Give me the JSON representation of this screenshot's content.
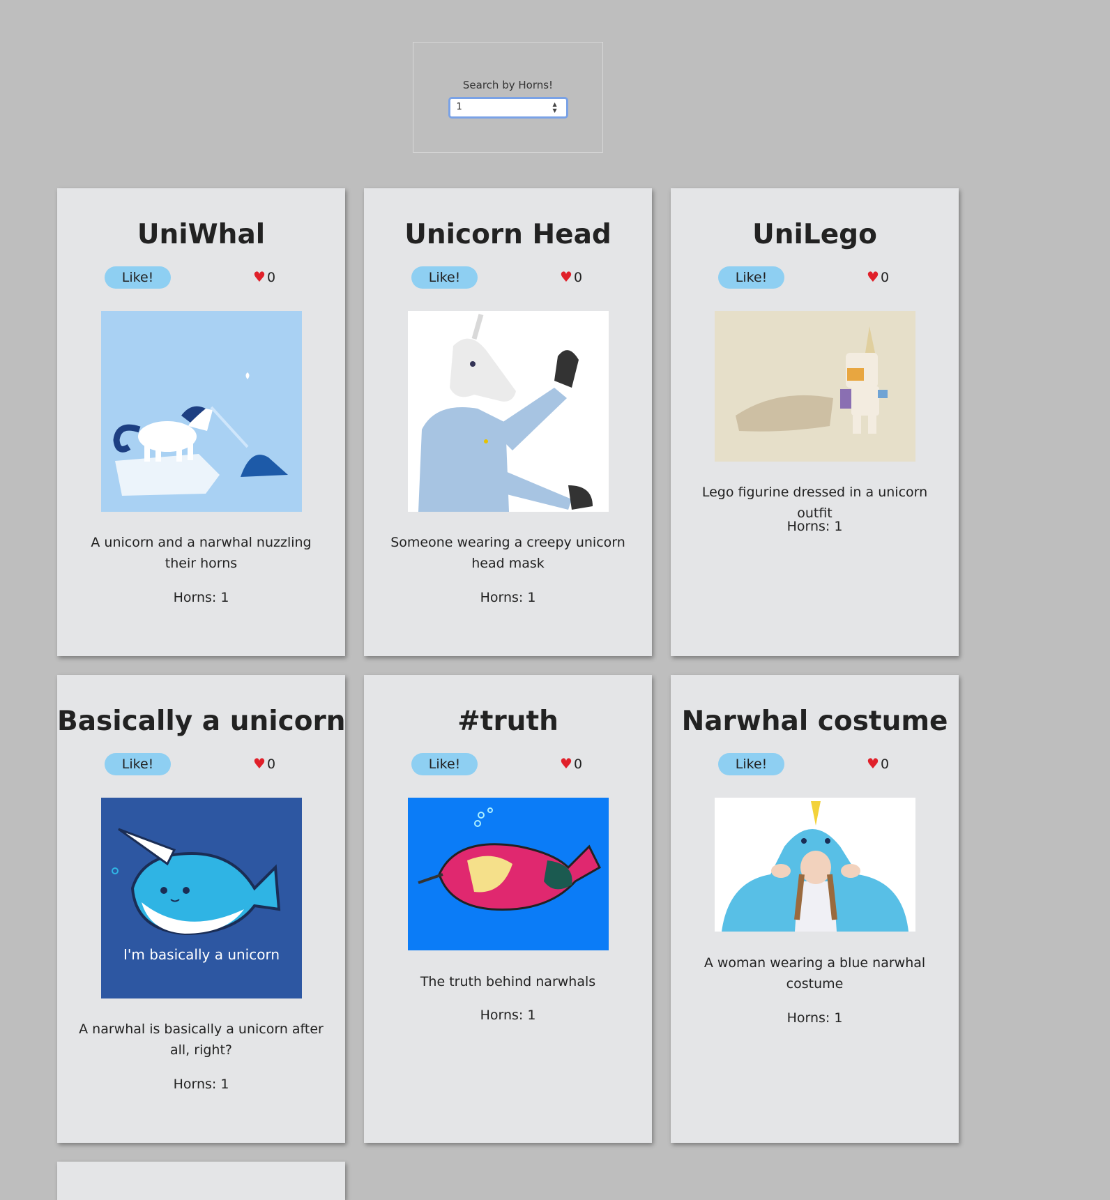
{
  "search": {
    "label": "Search by Horns!",
    "value": "1"
  },
  "cards": [
    {
      "title": "UniWhal",
      "like_label": "Like!",
      "likes": "0",
      "description": "A unicorn and a narwhal nuzzling their horns",
      "horns": "Horns: 1"
    },
    {
      "title": "Unicorn Head",
      "like_label": "Like!",
      "likes": "0",
      "description": "Someone wearing a creepy unicorn head mask",
      "horns": "Horns: 1"
    },
    {
      "title": "UniLego",
      "like_label": "Like!",
      "likes": "0",
      "description": "Lego figurine dressed in a unicorn outfit",
      "horns": "Horns: 1"
    },
    {
      "title": "Basically a unicorn",
      "like_label": "Like!",
      "likes": "0",
      "description": "A narwhal is basically a unicorn after all, right?",
      "horns": "Horns: 1",
      "image_caption": "I'm basically a unicorn"
    },
    {
      "title": "#truth",
      "like_label": "Like!",
      "likes": "0",
      "description": "The truth behind narwhals",
      "horns": "Horns: 1"
    },
    {
      "title": "Narwhal costume",
      "like_label": "Like!",
      "likes": "0",
      "description": "A woman wearing a blue narwhal costume",
      "horns": "Horns: 1"
    }
  ],
  "icons": {
    "heart": "heart-icon",
    "spinner": "spinner-arrows-icon"
  },
  "colors": {
    "background": "#bebebe",
    "card": "#e4e5e7",
    "like_button": "#8ecff2",
    "heart": "#e0202a"
  }
}
